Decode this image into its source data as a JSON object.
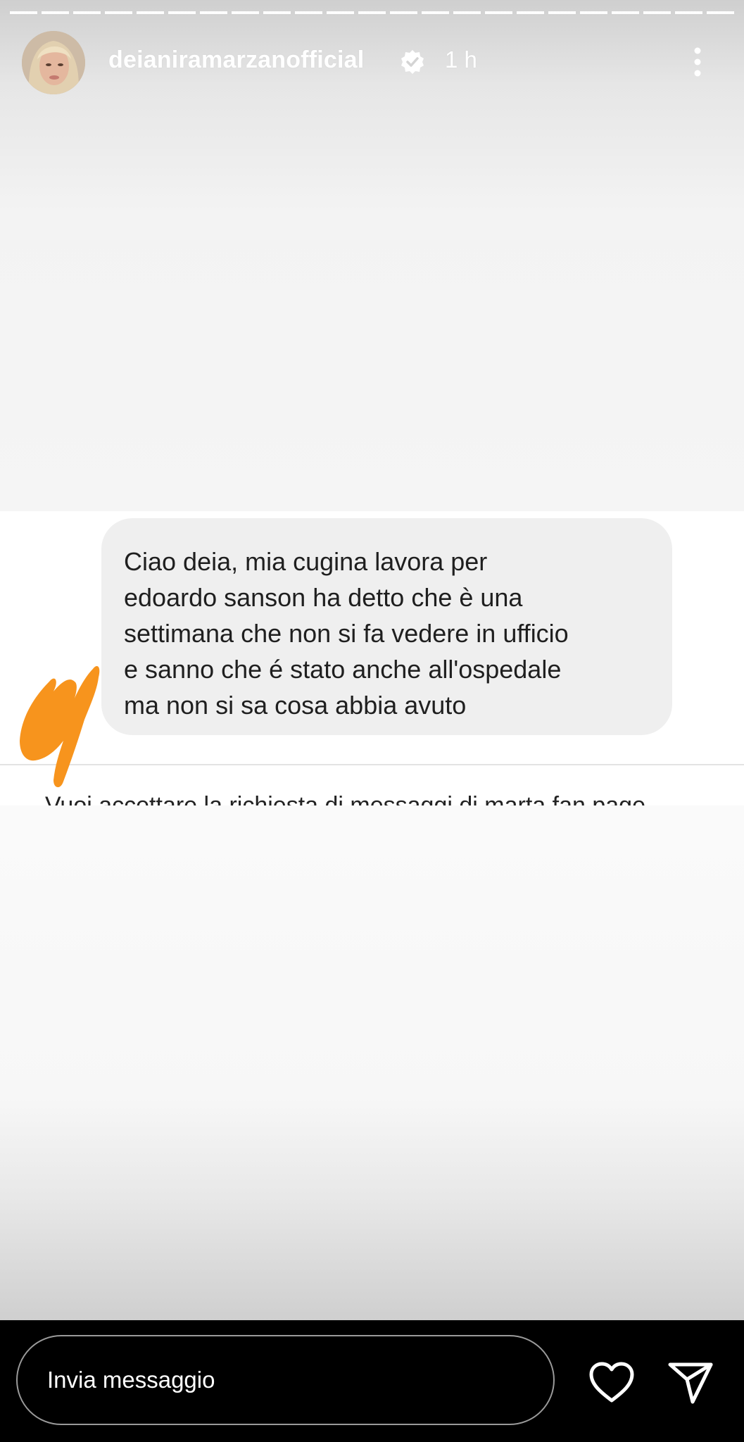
{
  "story": {
    "username": "deianiramarzanofficial",
    "time": "1 h",
    "icons": {
      "verified": "verified-badge-icon",
      "more": "more-options-icon"
    }
  },
  "dm": {
    "lines": [
      "Ciao deia, mia cugina lavora per",
      "edoardo sanson ha detto che è una",
      "settimana che non si fa vedere in ufficio",
      "e sanno che é stato anche all'ospedale",
      "ma non si sa cosa abbia avuto"
    ],
    "cut_off_text": "Vuoi accettare la richiesta di messaggi di marta fan page"
  },
  "scribble_color": "#F7941D",
  "reply": {
    "placeholder": "Invia messaggio",
    "icons": {
      "like": "heart-icon",
      "share": "send-icon"
    }
  }
}
